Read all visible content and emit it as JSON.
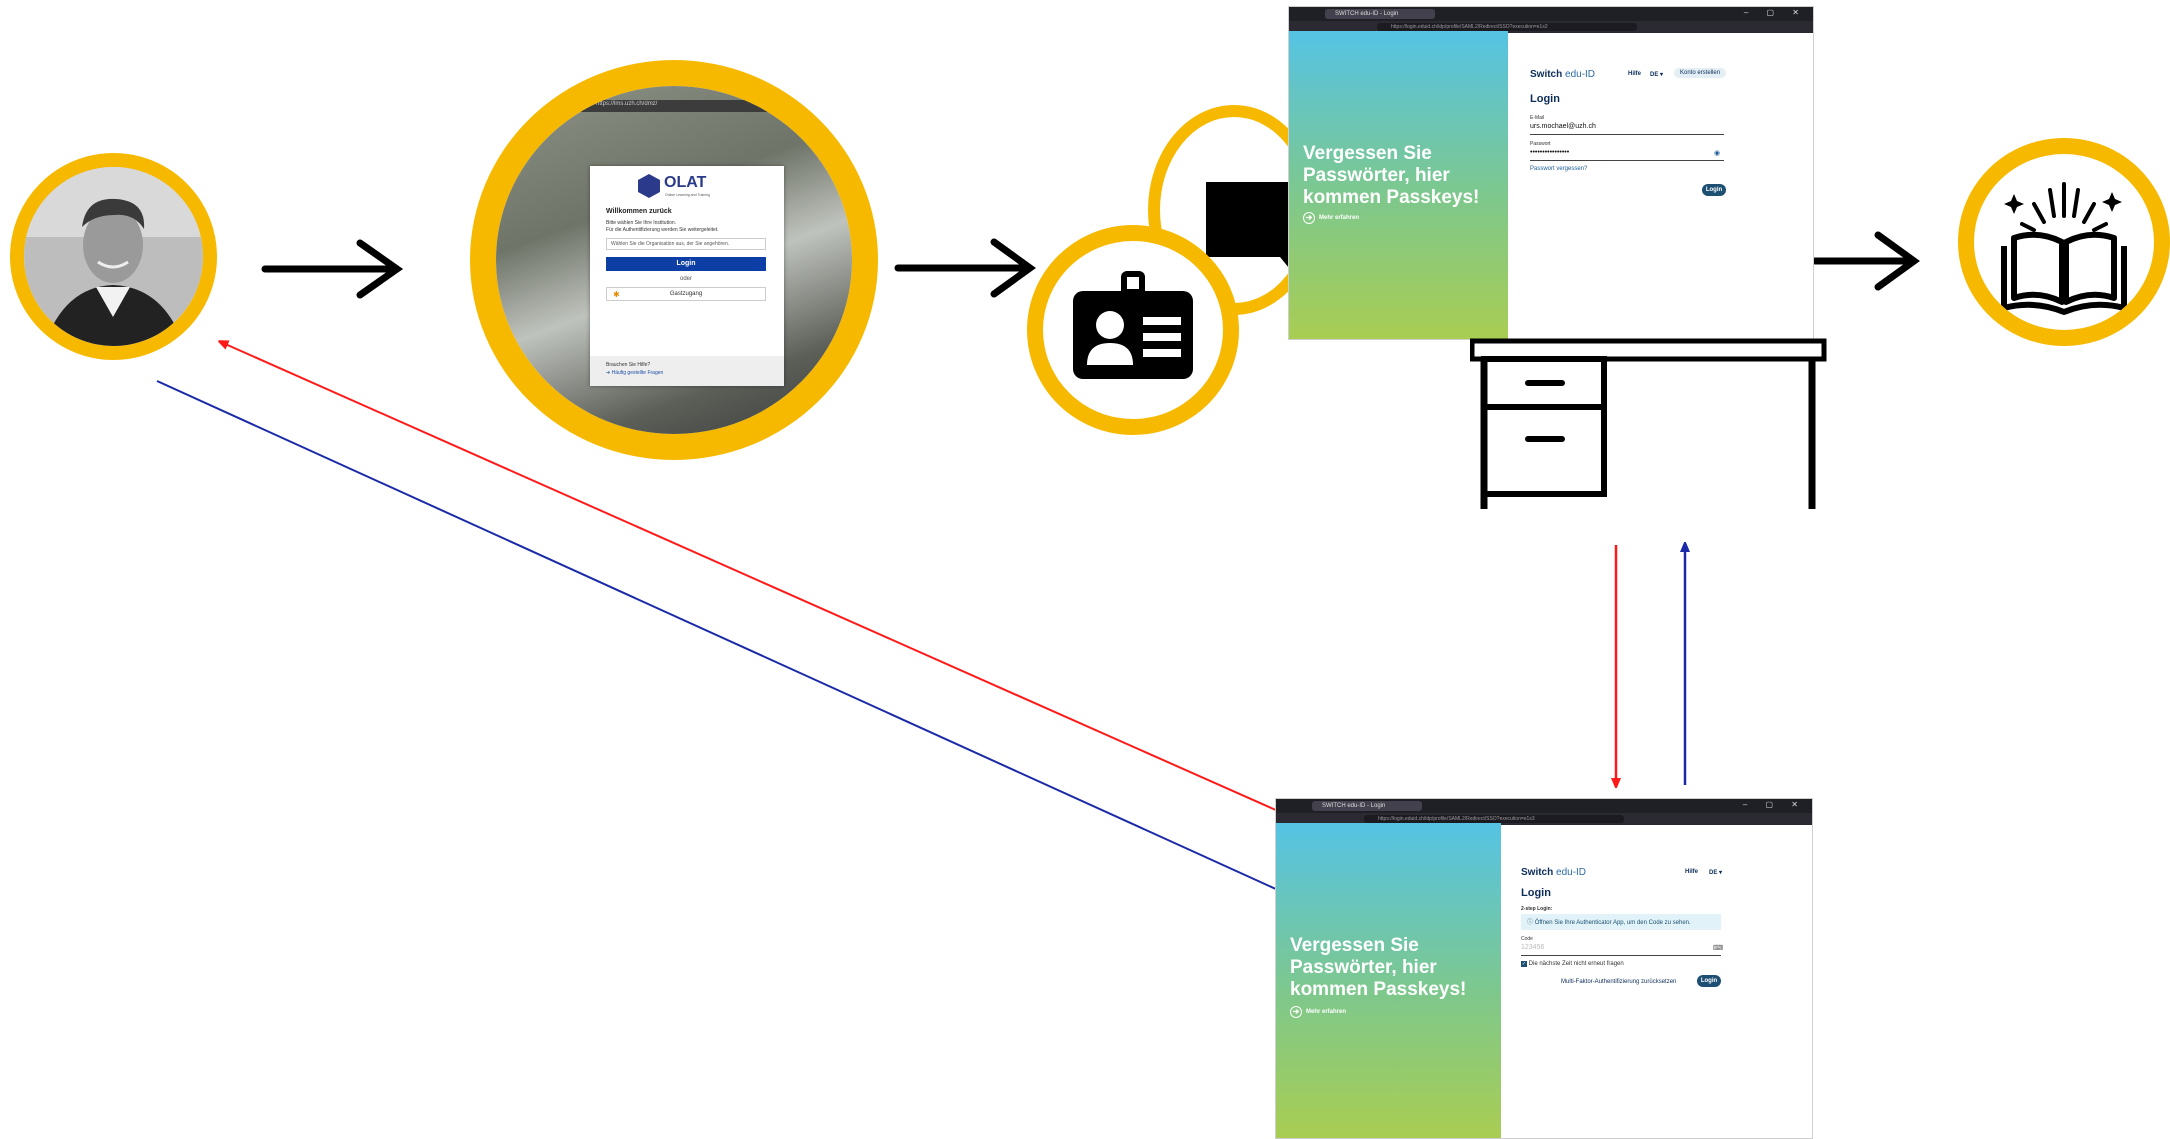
{
  "colors": {
    "ring": "#f7b900",
    "arrow": "#000000",
    "red_line": "#ff1a1a",
    "blue_line": "#1a2aa8"
  },
  "icons": [
    "person-photo",
    "id-card-icon",
    "speech-bubble-icon",
    "desk-icon",
    "open-book-icon"
  ],
  "olat": {
    "url": "https://lms.uzh.ch/dmz/",
    "logo": "OLAT",
    "logo_sub": "Online Learning and Training",
    "title": "Willkommen zurück",
    "line1": "Bitte wählen Sie Ihre Institution.",
    "line2": "Für die Authentifizierung werden Sie weitergeleitet.",
    "select_placeholder": "Wählen Sie die Organisation aus, der Sie angehören.",
    "login_button": "Login",
    "or": "oder",
    "guest_button": "Gastzugang",
    "help_q": "Brauchen Sie Hilfe?",
    "faq": "Häufig gestellte Fragen"
  },
  "eduid_top": {
    "tab": "SWITCH edu-ID - Login",
    "url": "https://login.eduid.ch/idp/profile/SAML2/Redirect/SSO?execution=e1s2",
    "slogan": "Vergessen Sie Passwörter, hier kommen Passkeys!",
    "more": "Mehr erfahren",
    "brand_a": "Switch",
    "brand_b": "edu-ID",
    "help": "Hilfe",
    "lang": "DE",
    "create_account": "Konto erstellen",
    "heading": "Login",
    "email_label": "E-Mail",
    "email_value": "urs.mochael@uzh.ch",
    "password_label": "Passwort",
    "password_value": "••••••••••••••••",
    "forgot": "Passwort vergessen?",
    "login_button": "Login"
  },
  "eduid_bottom": {
    "tab": "SWITCH edu-ID - Login",
    "url": "https://login.eduid.ch/idp/profile/SAML2/Redirect/SSO?execution=e1s3",
    "slogan": "Vergessen Sie Passwörter, hier kommen Passkeys!",
    "more": "Mehr erfahren",
    "brand_a": "Switch",
    "brand_b": "edu-ID",
    "help": "Hilfe",
    "lang": "DE",
    "heading": "Login",
    "step": "2-step Login:",
    "info": "Öffnen Sie Ihre Authenticator App, um den Code zu sehen.",
    "code_label": "Code",
    "code_placeholder": "123456",
    "remember": "Die nächste Zeit nicht erneut fragen",
    "reset": "Multi-Faktor-Authentifizierung zurücksetzen",
    "login_button": "Login"
  }
}
